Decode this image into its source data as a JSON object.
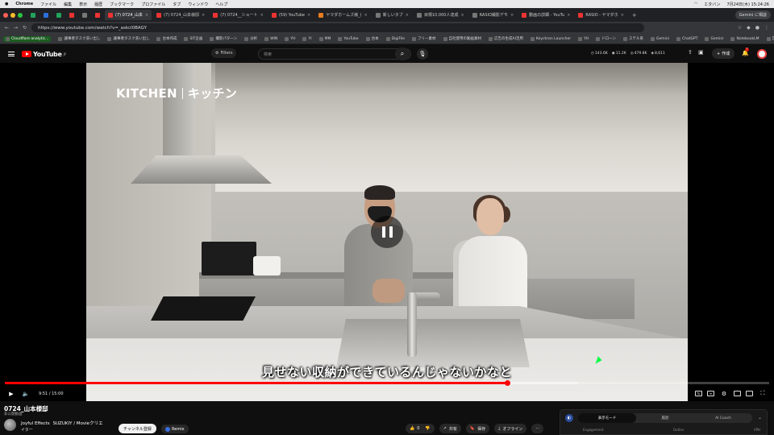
{
  "macos_menubar": {
    "app": "Chrome",
    "menus": [
      "ファイル",
      "編集",
      "表示",
      "履歴",
      "ブックマーク",
      "プロファイル",
      "タブ",
      "ウィンドウ",
      "ヘルプ"
    ],
    "battery": "エタバン",
    "clock": "7月24日(木) 15:24:26"
  },
  "tabs": [
    {
      "label": "",
      "fav": "green",
      "small": true
    },
    {
      "label": "",
      "fav": "blue",
      "small": true
    },
    {
      "label": "",
      "fav": "green",
      "small": true
    },
    {
      "label": "",
      "fav": "",
      "small": true
    },
    {
      "label": "",
      "fav": "gray",
      "small": true
    },
    {
      "label": "",
      "fav": "",
      "small": true
    },
    {
      "label": "(7) 0724_山本 ",
      "fav": "",
      "active": true
    },
    {
      "label": "(7) 0724_山本様邸",
      "fav": ""
    },
    {
      "label": "(7) 0724__ショート",
      "fav": ""
    },
    {
      "label": "(59) YouTube",
      "fav": ""
    },
    {
      "label": "ヤマダホームズ様_(",
      "fav": "orange"
    },
    {
      "label": "新しいタブ",
      "fav": "gray"
    },
    {
      "label": "目標10,000人達成",
      "fav": "gray"
    },
    {
      "label": "RASIO撮影デモ",
      "fav": "gray"
    },
    {
      "label": "動画の詳細 - YouTu",
      "fav": ""
    },
    {
      "label": "RASIO - ヤマダホ",
      "fav": ""
    }
  ],
  "gemini_button": "Gemini に相談",
  "address": {
    "url": "https://www.youtube.com/watch?v=_askcI0BAGY"
  },
  "bookmarks": [
    "Cloudflare analytic...",
    "議事者タスク洗い出し",
    "議事者タスク洗い出し",
    "台本作成",
    "SIT企画",
    "撮影パターン",
    "分析",
    "WIN",
    "YH",
    "YI",
    "MM",
    "YouTube",
    "台本",
    "DigiFile",
    "フリー素材",
    "自社使用の動画素材",
    "広告の生成AI活用",
    "Keychron Launcher",
    "YH",
    "ドローン",
    "ステル系",
    "Gemini",
    "ChatGPT",
    "Gemini",
    "NotebookLM",
    "営業",
    "撮影課",
    "便利サイト"
  ],
  "youtube": {
    "logo": "YouTube",
    "logo_region": "JP",
    "filters": "Filters",
    "search_placeholder": "検索",
    "stats": [
      "143.6K",
      "11.2K",
      "479.8K",
      "8,611"
    ],
    "create": "作成",
    "notif_count": "7"
  },
  "video": {
    "overlay_title_en": "KITCHEN",
    "overlay_title_jp": "キッチン",
    "subtitle": "見せない収納ができているんじゃないかなと",
    "time_current": "9:51",
    "time_total": "15:00",
    "progress": 0.657,
    "buffered": 0.75
  },
  "below": {
    "title": "0724_山本様邸",
    "meta": "非公開動画",
    "channel": "Joyful Effects",
    "crew": "SUZUKIY / Movieクリエ",
    "channel_sub": "イター",
    "subscribe": "チャンネル登録",
    "remix": "Remix",
    "likes": "0",
    "share": "共有",
    "save": "保存",
    "offline": "オフライン"
  },
  "panel": {
    "tabs": [
      "表示モード",
      "履歴",
      "AI Coach"
    ],
    "cols": [
      "Engagement",
      "Outlier",
      "VPH"
    ]
  }
}
